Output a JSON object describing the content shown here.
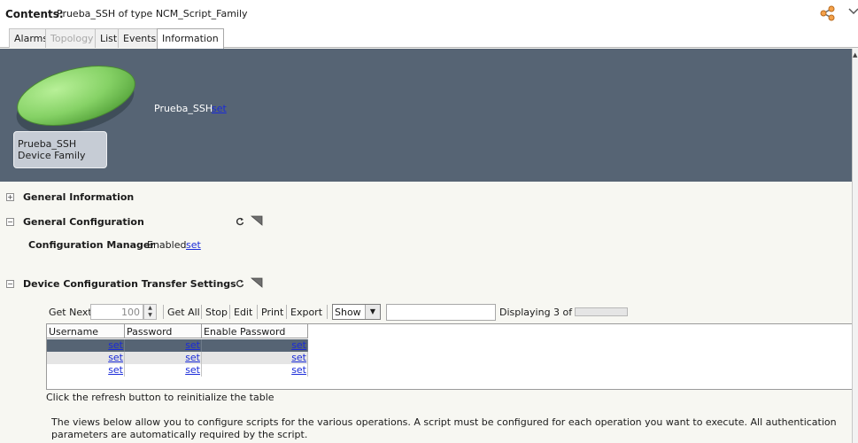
{
  "header": {
    "title_label": "Contents:",
    "title_text": "Prueba_SSH of type NCM_Script_Family"
  },
  "tabs": [
    {
      "label": "Alarms",
      "state": "normal"
    },
    {
      "label": "Topology",
      "state": "disabled"
    },
    {
      "label": "List",
      "state": "normal"
    },
    {
      "label": "Events",
      "state": "normal"
    },
    {
      "label": "Information",
      "state": "active"
    }
  ],
  "banner": {
    "device_name": "Prueba_SSH",
    "device_type": "Device Family",
    "name": "Prueba_SSH",
    "set_label": "set"
  },
  "sections": {
    "general_information": "General Information",
    "general_configuration": "General Configuration",
    "transfer_settings": "Device Configuration Transfer Settings"
  },
  "config": {
    "label": "Configuration Manager",
    "value": "Enabled",
    "set_label": "set"
  },
  "toolbar": {
    "get_next": "Get Next",
    "get_next_value": "100",
    "get_all": "Get All",
    "stop": "Stop",
    "edit": "Edit",
    "print": "Print",
    "export": "Export",
    "show": "Show",
    "displaying": "Displaying 3 of 3"
  },
  "table": {
    "columns": [
      "Username",
      "Password",
      "Enable Password"
    ],
    "rows": [
      [
        "set",
        "set",
        "set"
      ],
      [
        "set",
        "set",
        "set"
      ],
      [
        "set",
        "set",
        "set"
      ]
    ]
  },
  "footer": {
    "refresh_note": "Click the refresh button to reinitialize the table",
    "description": "The views below allow you to configure scripts for the various operations. A script must be configured for each operation you want to execute. All authentication parameters are automatically required by the script."
  },
  "colors": {
    "banner": "#566474",
    "link": "#1a2bd8",
    "disc": "#8fd674"
  }
}
